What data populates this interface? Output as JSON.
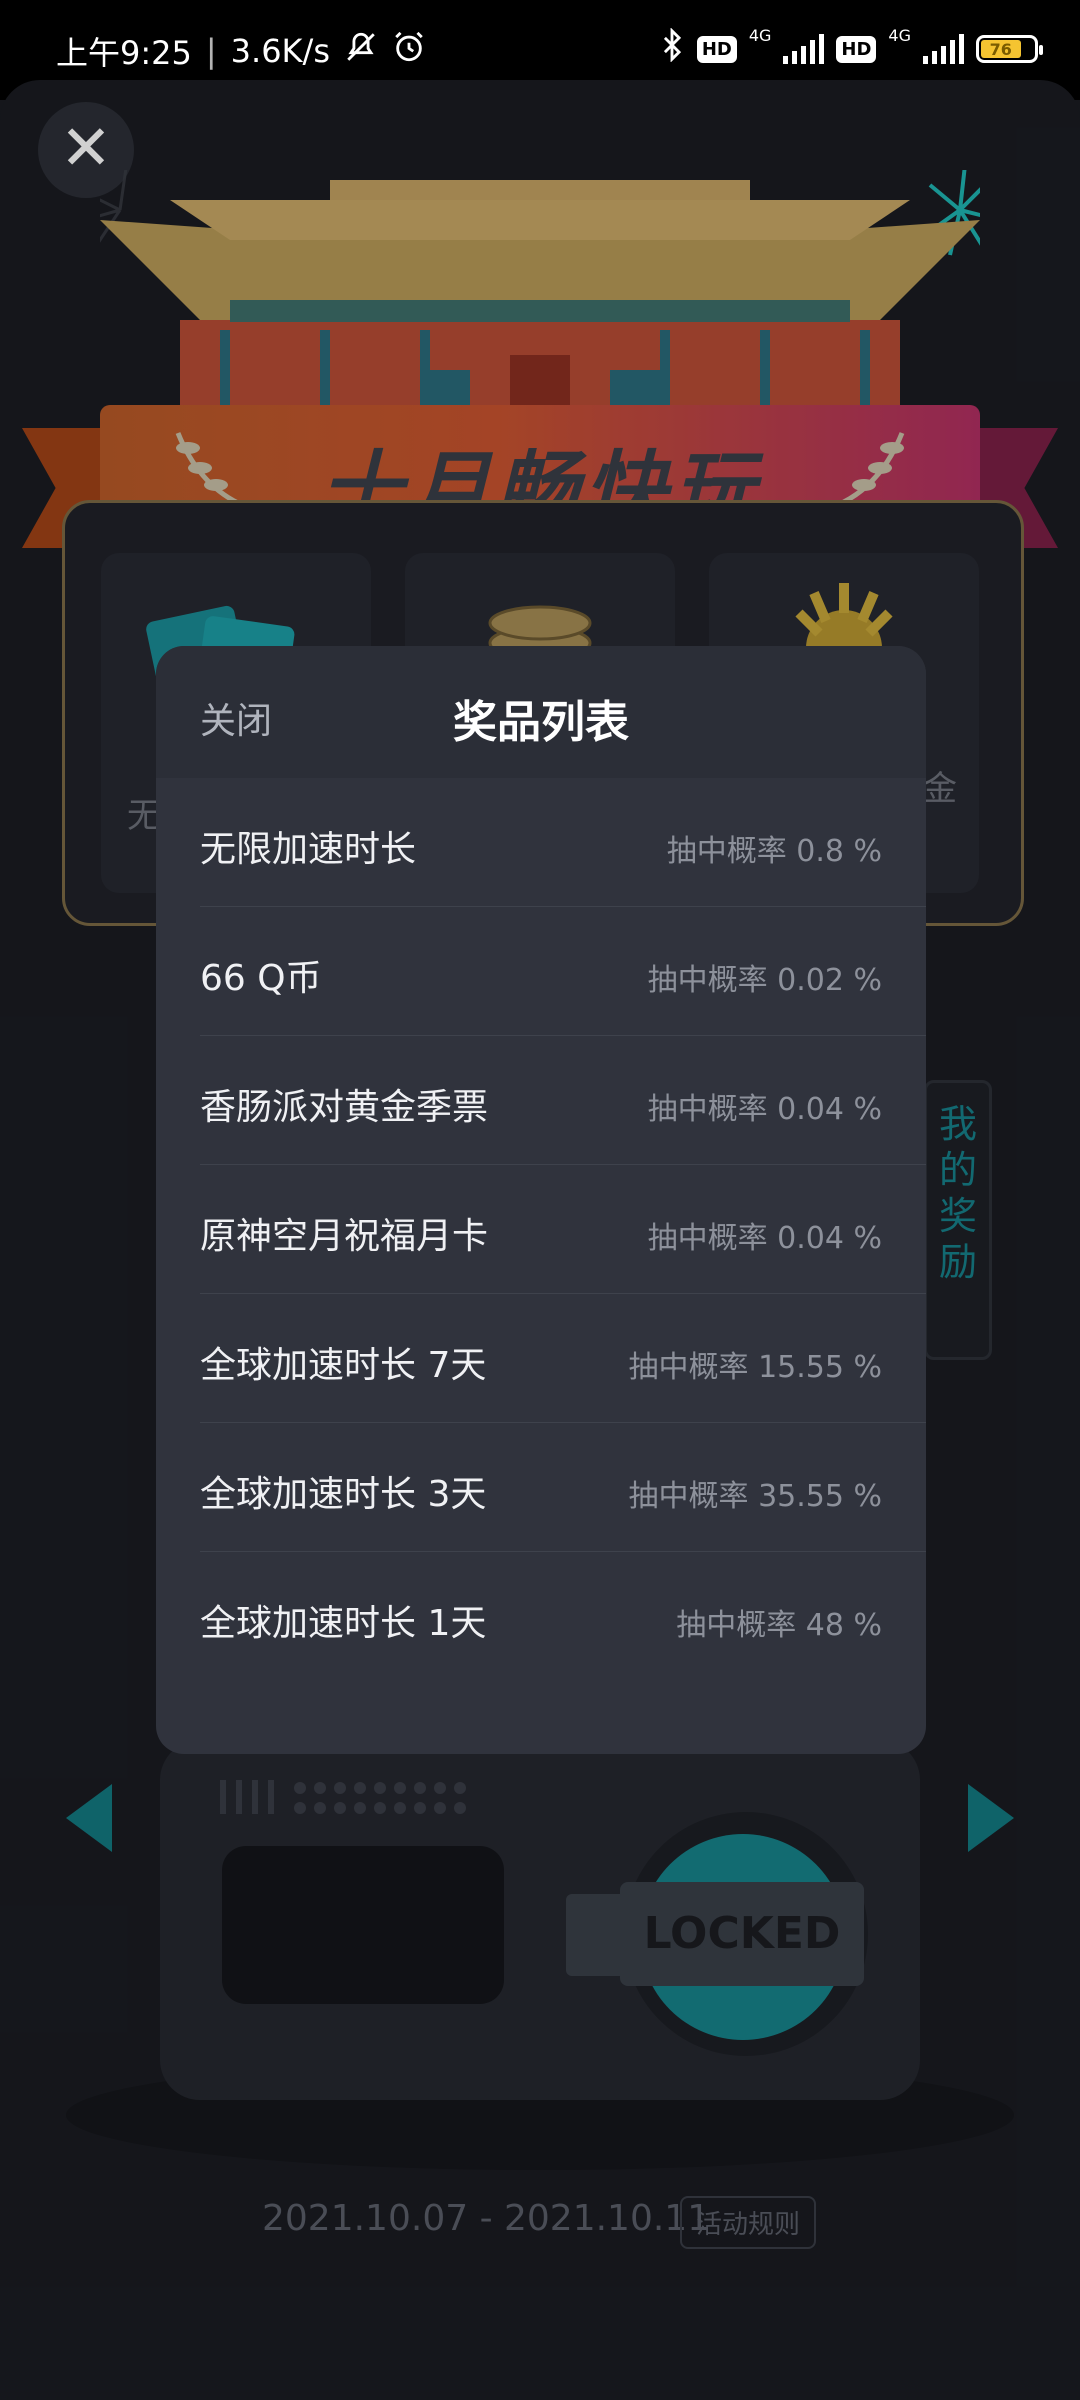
{
  "status_bar": {
    "time": "上午9:25",
    "network_speed": "3.6K/s",
    "sig1": "4G",
    "sig2": "4G",
    "hd": "HD",
    "battery": "76"
  },
  "background": {
    "banner_title": "十月畅快玩",
    "partial_left": "无",
    "partial_right": "金",
    "side_button": "我的奖励",
    "locked_label": "LOCKED",
    "date_range": "2021.10.07 - 2021.10.11",
    "rules_label": "活动规则"
  },
  "modal": {
    "close_label": "关闭",
    "title": "奖品列表",
    "items": [
      {
        "name": "无限加速时长",
        "prob": "抽中概率 0.8 %"
      },
      {
        "name": "66 Q币",
        "prob": "抽中概率 0.02 %"
      },
      {
        "name": "香肠派对黄金季票",
        "prob": "抽中概率 0.04 %"
      },
      {
        "name": "原神空月祝福月卡",
        "prob": "抽中概率 0.04 %"
      },
      {
        "name": "全球加速时长 7天",
        "prob": "抽中概率 15.55 %"
      },
      {
        "name": "全球加速时长 3天",
        "prob": "抽中概率 35.55 %"
      },
      {
        "name": "全球加速时长 1天",
        "prob": "抽中概率 48 %"
      }
    ]
  },
  "colors": {
    "accent_teal": "#17838a",
    "modal_bg": "#30333d",
    "page_bg": "#1a1c22"
  }
}
